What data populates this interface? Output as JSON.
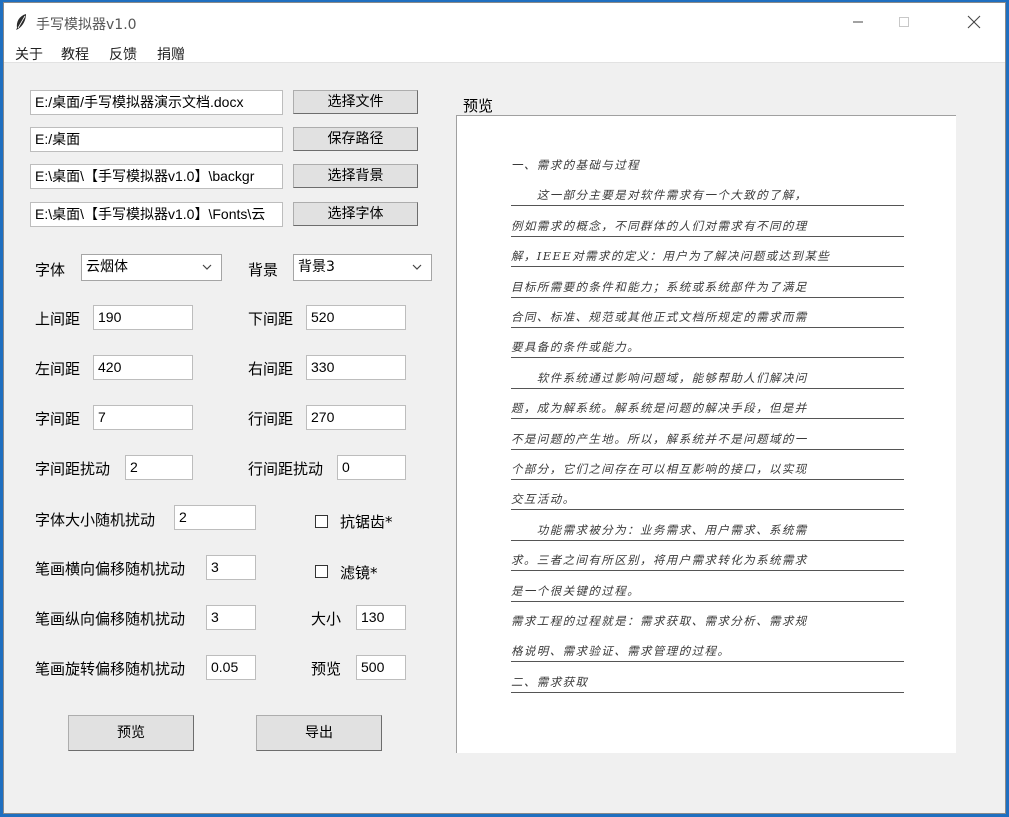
{
  "window": {
    "title": "手写模拟器v1.0"
  },
  "menu": [
    "关于",
    "教程",
    "反馈",
    "捐赠"
  ],
  "paths": [
    {
      "value": "E:/桌面/手写模拟器演示文档.docx",
      "button": "选择文件"
    },
    {
      "value": "E:/桌面",
      "button": "保存路径"
    },
    {
      "value": "E:\\桌面\\【手写模拟器v1.0】\\backgr",
      "button": "选择背景"
    },
    {
      "value": "E:\\桌面\\【手写模拟器v1.0】\\Fonts\\云",
      "button": "选择字体"
    }
  ],
  "font": {
    "label": "字体",
    "value": "云烟体"
  },
  "background": {
    "label": "背景",
    "value": "背景3"
  },
  "params": {
    "top_margin": {
      "label": "上间距",
      "value": "190"
    },
    "bottom_margin": {
      "label": "下间距",
      "value": "520"
    },
    "left_margin": {
      "label": "左间距",
      "value": "420"
    },
    "right_margin": {
      "label": "右间距",
      "value": "330"
    },
    "char_spacing": {
      "label": "字间距",
      "value": "7"
    },
    "line_spacing": {
      "label": "行间距",
      "value": "270"
    },
    "char_spacing_jitter": {
      "label": "字间距扰动",
      "value": "2"
    },
    "line_spacing_jitter": {
      "label": "行间距扰动",
      "value": "0"
    },
    "font_size_jitter": {
      "label": "字体大小随机扰动",
      "value": "2"
    },
    "stroke_h_jitter": {
      "label": "笔画横向偏移随机扰动",
      "value": "3"
    },
    "stroke_v_jitter": {
      "label": "笔画纵向偏移随机扰动",
      "value": "3"
    },
    "stroke_rot_jitter": {
      "label": "笔画旋转偏移随机扰动",
      "value": "0.05"
    },
    "size": {
      "label": "大小",
      "value": "130"
    },
    "preview_res": {
      "label": "预览",
      "value": "500"
    }
  },
  "checks": {
    "antialias": {
      "label": "抗锯齿*",
      "checked": false
    },
    "filter": {
      "label": "滤镜*",
      "checked": false
    }
  },
  "actions": {
    "preview": "预览",
    "export": "导出"
  },
  "preview": {
    "label": "预览",
    "lines": [
      "一、需求的基础与过程",
      "　　这一部分主要是对软件需求有一个大致的了解，",
      "例如需求的概念，不同群体的人们对需求有不同的理",
      "解，IEEE对需求的定义：用户为了解决问题或达到某些",
      "目标所需要的条件和能力；系统或系统部件为了满足",
      "合同、标准、规范或其他正式文档所规定的需求而需",
      "要具备的条件或能力。",
      "　　软件系统通过影响问题域，能够帮助人们解决问",
      "题，成为解系统。解系统是问题的解决手段，但是并",
      "不是问题的产生地。所以，解系统并不是问题域的一",
      "个部分，它们之间存在可以相互影响的接口，以实现",
      "交互活动。",
      "　　功能需求被分为：业务需求、用户需求、系统需",
      "求。三者之间有所区别，将用户需求转化为系统需求",
      "是一个很关键的过程。",
      "需求工程的过程就是：需求获取、需求分析、需求规",
      "格说明、需求验证、需求管理的过程。",
      "二、需求获取"
    ]
  }
}
